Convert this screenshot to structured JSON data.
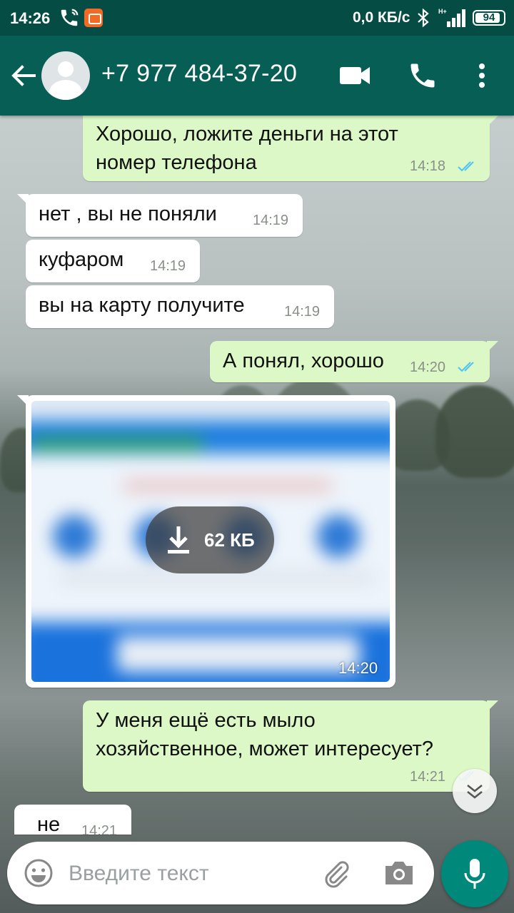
{
  "status_bar": {
    "time": "14:26",
    "network_speed": "0,0 КБ/с",
    "network_type": "H+",
    "battery": "94",
    "icons": [
      "phone-call-icon",
      "app-notification-icon",
      "bluetooth-icon",
      "signal-icon",
      "battery-icon"
    ]
  },
  "header": {
    "contact": "+7 977 484-37-20",
    "icons": [
      "back-arrow-icon",
      "avatar",
      "video-call-icon",
      "phone-icon",
      "more-vert-icon"
    ]
  },
  "messages": [
    {
      "direction": "out",
      "text_lines": [
        "Хорошо, ложите деньги на этот",
        "номер телефона"
      ],
      "time": "14:18",
      "status": "read"
    },
    {
      "direction": "in",
      "text": "нет , вы не поняли",
      "time": "14:19"
    },
    {
      "direction": "in",
      "text": "куфаром",
      "time": "14:19"
    },
    {
      "direction": "in",
      "text": "вы на карту получите",
      "time": "14:19"
    },
    {
      "direction": "out",
      "text": "А понял, хорошо",
      "time": "14:20",
      "status": "read"
    },
    {
      "direction": "in",
      "type": "image",
      "download_size": "62 КБ",
      "time": "14:20"
    },
    {
      "direction": "out",
      "text_lines": [
        "У меня ещё есть мыло",
        "хозяйственное, может интересует?"
      ],
      "time": "14:21",
      "status": "read"
    },
    {
      "direction": "in",
      "text": "не",
      "time": "14:21"
    }
  ],
  "composer": {
    "placeholder": "Введите текст",
    "icons": [
      "emoji-icon",
      "attach-icon",
      "camera-icon",
      "mic-icon"
    ]
  },
  "colors": {
    "header": "#075e54",
    "status_bar": "#054d44",
    "outgoing_bubble": "#dcf8c6",
    "incoming_bubble": "#ffffff",
    "read_tick": "#4fc3f7",
    "fab": "#00897b"
  }
}
